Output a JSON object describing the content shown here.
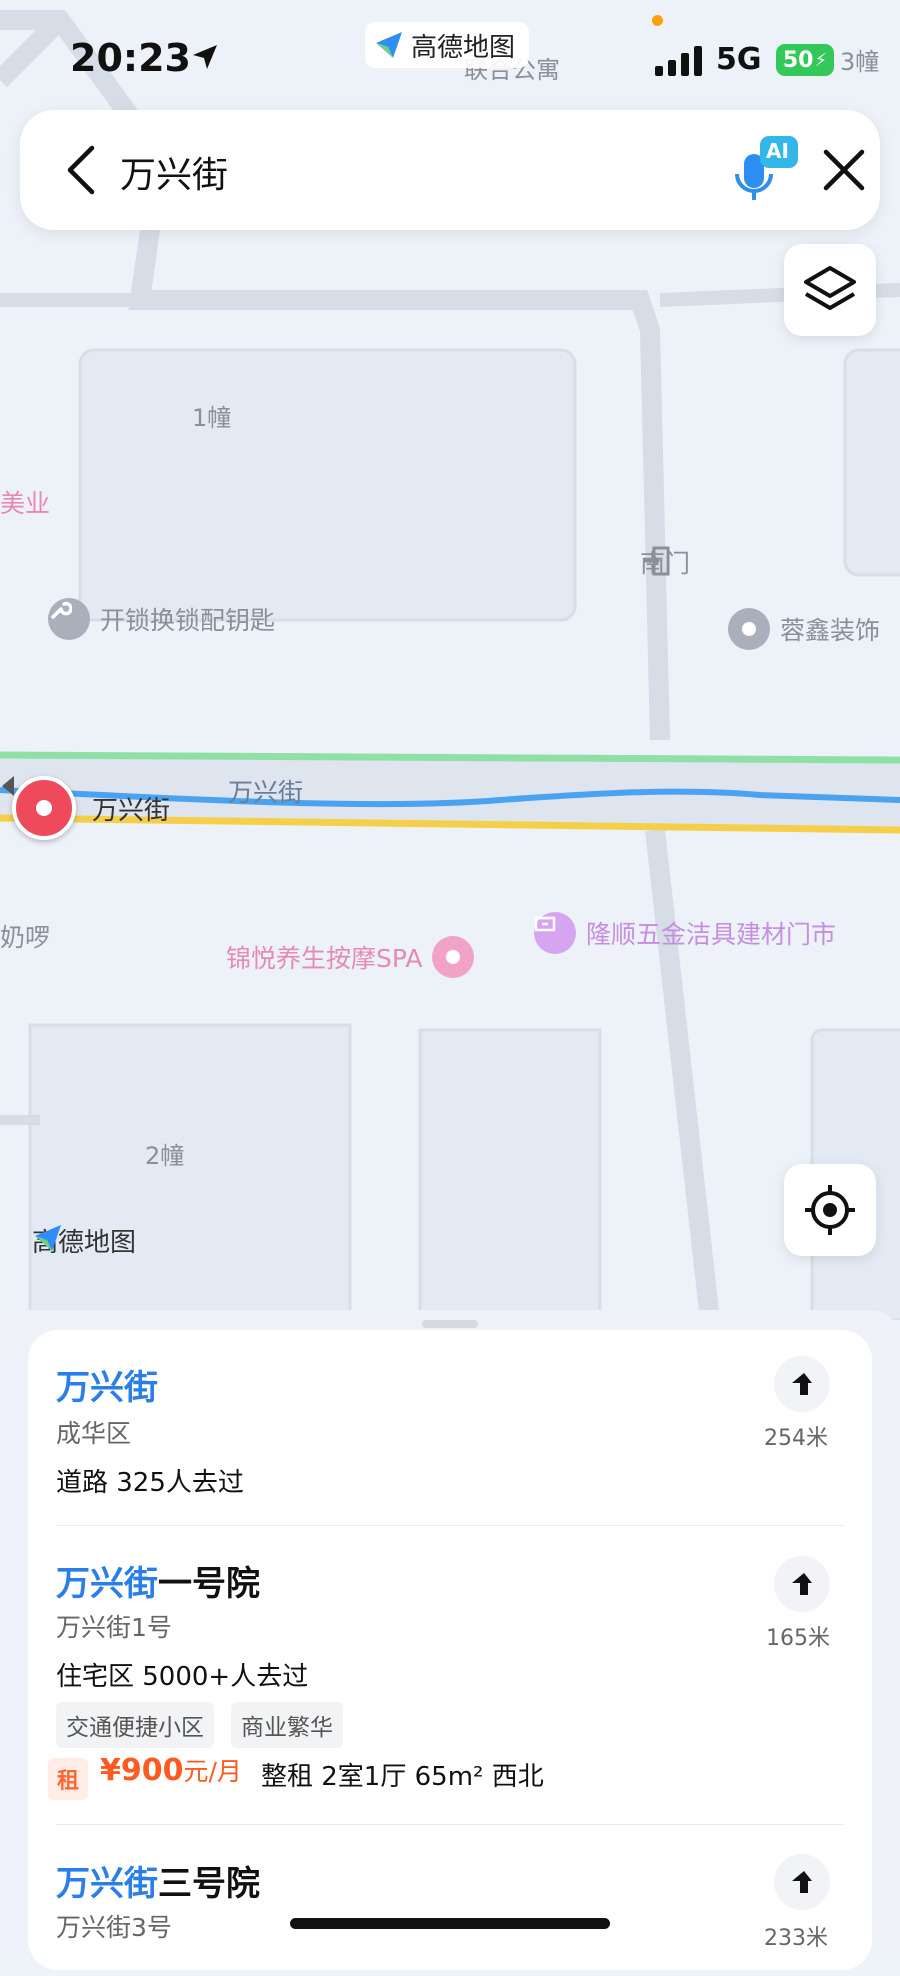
{
  "status": {
    "time": "20:23",
    "app_label": "高德地图",
    "network": "5G",
    "battery": "50"
  },
  "search": {
    "query": "万兴街",
    "ai_label": "AI"
  },
  "map": {
    "labels": {
      "top_building": "联合公寓",
      "top_right": "3幢",
      "b1": "1幢",
      "b2": "2幢",
      "beauty": "美业",
      "south_gate": "南门",
      "locksmith": "开锁换锁配钥匙",
      "decoration": "蓉鑫装饰",
      "street_pin": "万兴街",
      "street_road": "万兴街",
      "milk": "奶啰",
      "spa": "锦悦养生按摩SPA",
      "hardware": "隆顺五金洁具建材门市"
    },
    "watermark": "高德地图"
  },
  "results": [
    {
      "title_hl": "万兴街",
      "title_rest": "",
      "sub": "成华区",
      "meta": "道路  325人去过",
      "distance": "254米"
    },
    {
      "title_hl": "万兴街",
      "title_rest": "一号院",
      "sub": "万兴街1号",
      "meta": "住宅区  5000+人去过",
      "tags": [
        "交通便捷小区",
        "商业繁华"
      ],
      "rent": {
        "badge": "租",
        "price": "¥900",
        "unit": "元/月",
        "desc": "整租 2室1厅 65m² 西北"
      },
      "distance": "165米"
    },
    {
      "title_hl": "万兴街",
      "title_rest": "三号院",
      "sub": "万兴街3号",
      "distance": "233米"
    }
  ]
}
